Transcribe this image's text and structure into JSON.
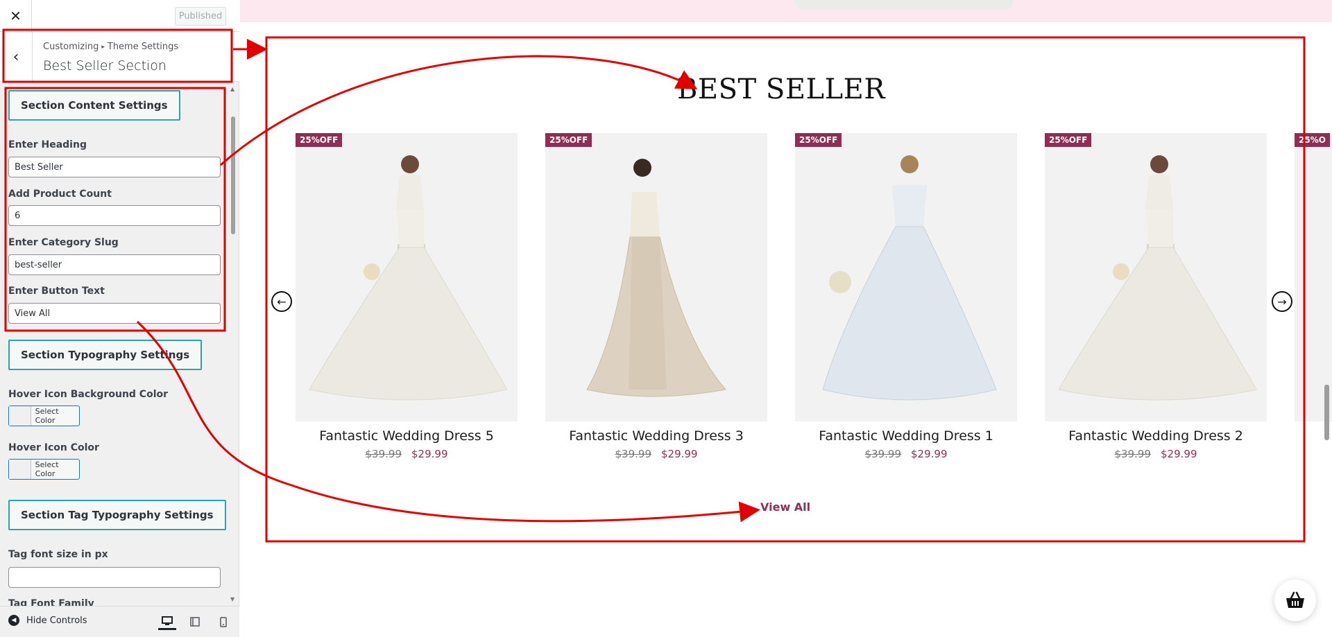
{
  "sidebar": {
    "close_icon": "close-icon",
    "published_label": "Published",
    "breadcrumb": [
      "Customizing",
      "Theme Settings"
    ],
    "breadcrumb_sep": "▸",
    "section_title": "Best Seller Section",
    "groups": {
      "content": "Section Content Settings",
      "typography": "Section Typography Settings",
      "tag_typography": "Section Tag Typography Settings"
    },
    "fields": {
      "heading": {
        "label": "Enter Heading",
        "value": "Best Seller"
      },
      "product_count": {
        "label": "Add Product Count",
        "value": "6"
      },
      "category_slug": {
        "label": "Enter Category Slug",
        "value": "best-seller"
      },
      "button_text": {
        "label": "Enter Button Text",
        "value": "View All"
      },
      "hover_bg_color": {
        "label": "Hover Icon Background Color",
        "button": "Select Color"
      },
      "hover_icon_color": {
        "label": "Hover Icon Color",
        "button": "Select Color"
      },
      "tag_font_size": {
        "label": "Tag font size in px",
        "value": ""
      },
      "tag_font_family": {
        "label": "Tag Font Family"
      }
    },
    "footer": {
      "hide_controls": "Hide Controls"
    }
  },
  "preview": {
    "section_heading": "BEST SELLER",
    "products": [
      {
        "badge": "25%OFF",
        "title": "Fantastic Wedding Dress 5",
        "old_price": "$39.99",
        "price": "$29.99"
      },
      {
        "badge": "25%OFF",
        "title": "Fantastic Wedding Dress 3",
        "old_price": "$39.99",
        "price": "$29.99"
      },
      {
        "badge": "25%OFF",
        "title": "Fantastic Wedding Dress 1",
        "old_price": "$39.99",
        "price": "$29.99"
      },
      {
        "badge": "25%OFF",
        "title": "Fantastic Wedding Dress 2",
        "old_price": "$39.99",
        "price": "$29.99"
      }
    ],
    "partial_badge": "25%O",
    "view_all": "View All"
  },
  "colors": {
    "accent_teal": "#2ea3a3",
    "badge": "#8d2f55",
    "annotation_red": "#e00000"
  }
}
